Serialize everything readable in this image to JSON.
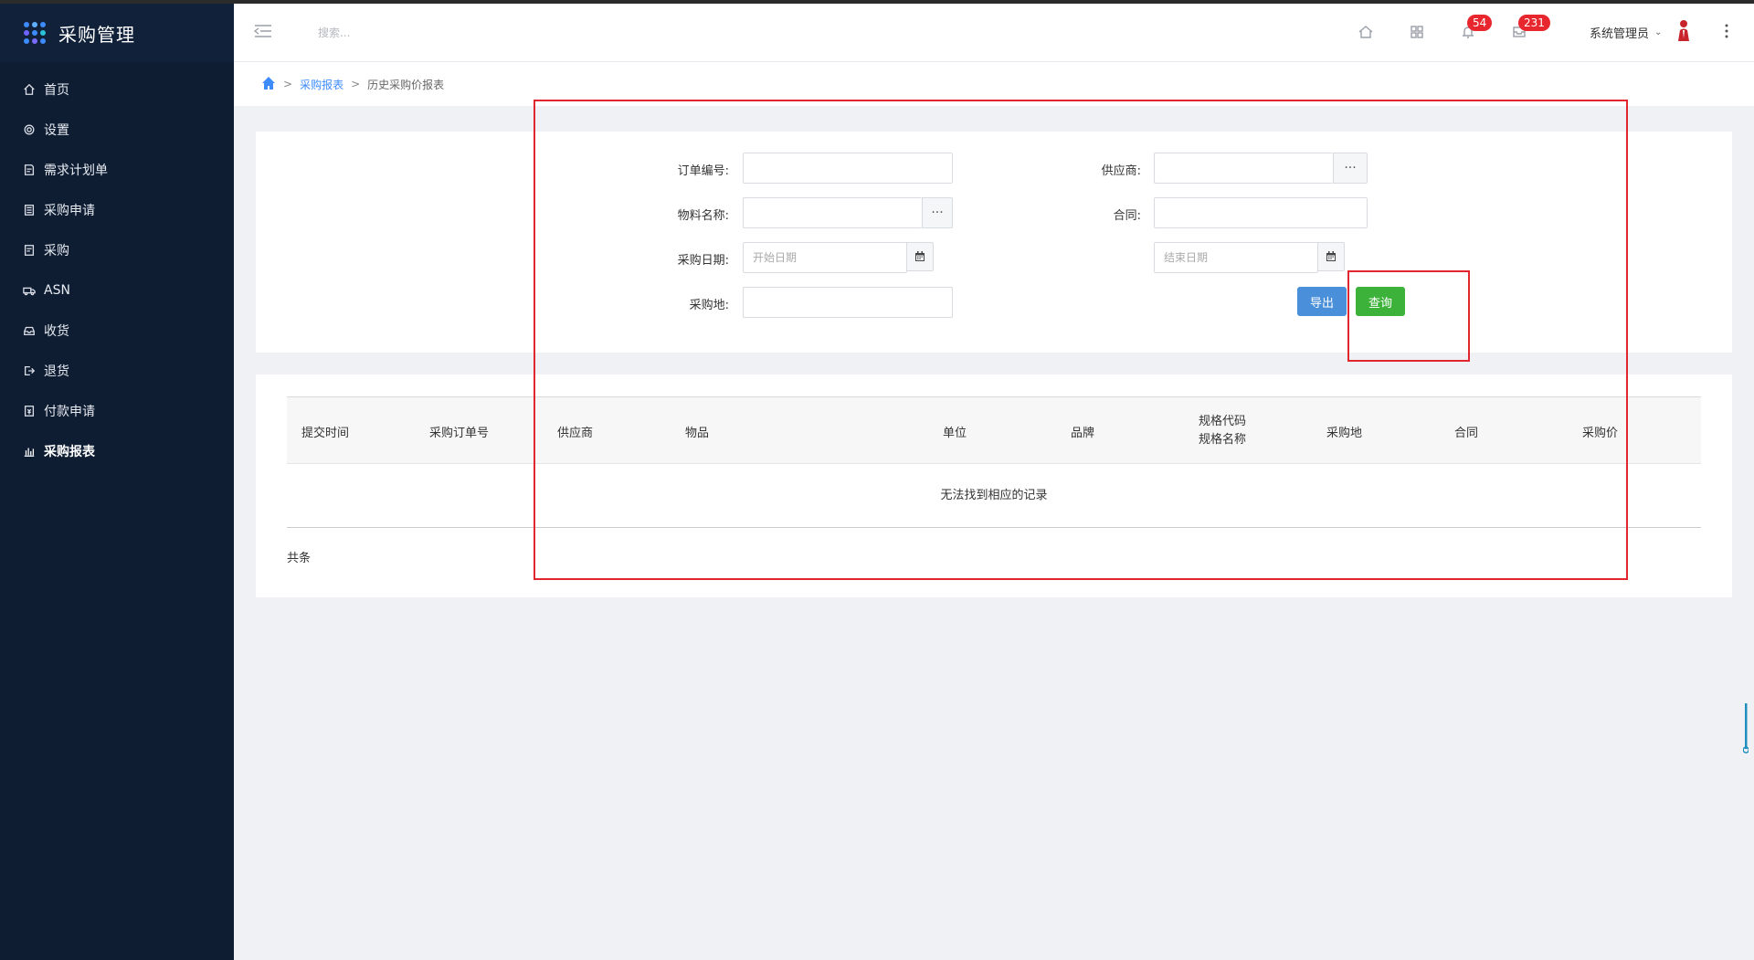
{
  "app": {
    "title": "采购管理"
  },
  "sidebar": {
    "items": [
      {
        "label": "首页",
        "icon": "home-icon"
      },
      {
        "label": "设置",
        "icon": "gear-icon"
      },
      {
        "label": "需求计划单",
        "icon": "doc-icon"
      },
      {
        "label": "采购申请",
        "icon": "doc-list-icon"
      },
      {
        "label": "采购",
        "icon": "clipboard-icon"
      },
      {
        "label": "ASN",
        "icon": "truck-icon"
      },
      {
        "label": "收货",
        "icon": "inbox-icon"
      },
      {
        "label": "退货",
        "icon": "return-icon"
      },
      {
        "label": "付款申请",
        "icon": "payment-icon"
      },
      {
        "label": "采购报表",
        "icon": "bar-chart-icon",
        "active": true
      }
    ]
  },
  "header": {
    "search_placeholder": "搜索...",
    "notifications_count": "54",
    "messages_count": "231",
    "user_name": "系统管理员"
  },
  "breadcrumb": {
    "parent": "采购报表",
    "current": "历史采购价报表",
    "separator": ">"
  },
  "form": {
    "order_no_label": "订单编号:",
    "supplier_label": "供应商:",
    "material_label": "物料名称:",
    "contract_label": "合同:",
    "date_label": "采购日期:",
    "start_date_placeholder": "开始日期",
    "end_date_placeholder": "结束日期",
    "place_label": "采购地:",
    "more_glyph": "···",
    "export_button": "导出",
    "query_button": "查询"
  },
  "table": {
    "columns": [
      "提交时间",
      "采购订单号",
      "供应商",
      "物品",
      "单位",
      "品牌",
      "规格代码",
      "规格名称",
      "采购地",
      "合同",
      "采购价"
    ],
    "empty_message": "无法找到相应的记录",
    "footer": "共条"
  },
  "colors": {
    "sidebar_bg": "#0f1d33",
    "accent": "#3d8bfd",
    "export_button": "#4a8fd9",
    "query_button": "#3db23a",
    "badge": "#e8262d",
    "annotation": "#e2262d"
  }
}
